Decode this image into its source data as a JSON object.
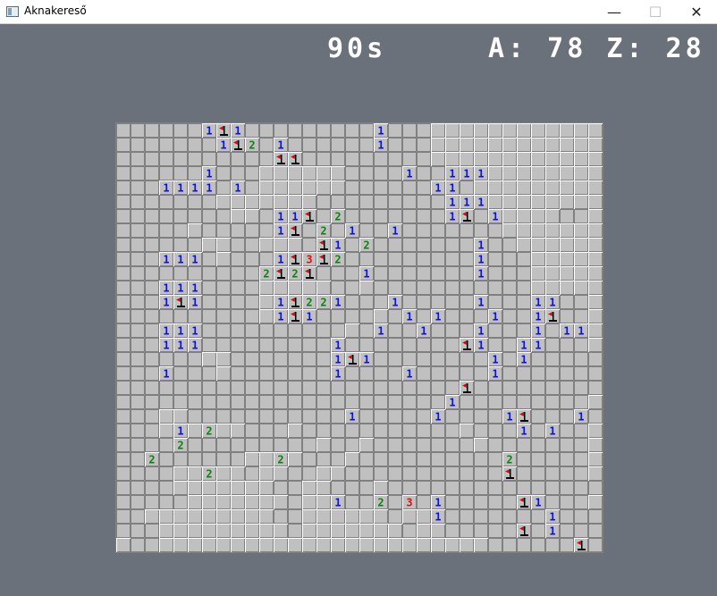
{
  "window": {
    "title": "Aknakereső",
    "controls": {
      "minimize": "—",
      "maximize": "☐",
      "close": "✕"
    }
  },
  "hud": {
    "timer": "90s",
    "stats": "A: 78 Z: 28"
  },
  "board": {
    "cols": 34,
    "rows": 30,
    "legend": {
      "#": "opened empty",
      ".": "unopened",
      "F": "flag",
      "1-3": "opened number"
    },
    "colors": {
      "1": "#1010e0",
      "2": "#108010",
      "3": "#e01010",
      "flag": "#d01010",
      "grid": "#808080",
      "cell": "#c0c0c0"
    },
    "grid": [
      "......1F1.........1...############",
      ".......1F2.1......1...############",
      "...........FF.........############",
      "......1...######....1..111########",
      "...1111.1.######......11.#########",
      ".......#######.........111########",
      "........##.11F.2.......1F.1####..#",
      ".....#.....1F.2.1..1.......#######",
      "......##..###.F1.2.......1..######",
      "...111.#...1F3F2.........1...#####",
      "..........2F2F...1.......1...#####",
      "...111....#####..#...........#####",
      "...1F1....#1F221...1.....1...11..#",
      "..........#1F1....#.1.1...1..1F..#",
      "...111..........#.1..1...1...1.11#",
      "...111.........1........F1..11...#",
      "......##.......1F1........1.1.....",
      "...1...#.......1....1.....1.......",
      "........................F.........",
      ".......................1.........#",
      "...##...........1.....1....1F...1.",
      "...#1#2##...#...........#...1.1..#",
      "....2.........#..#.......#.......#",
      "..2......##2#...#..........2.....#",
      "....##2##.##..##...........F.....#",
      "....#######..##...#...............",
      ".....#######.##1..2.3.1.....F1...#",
      "..#########..######.##1.......1...",
      "...#########.#######.##.....F.1...",
      "#..#######################......F."
    ]
  }
}
